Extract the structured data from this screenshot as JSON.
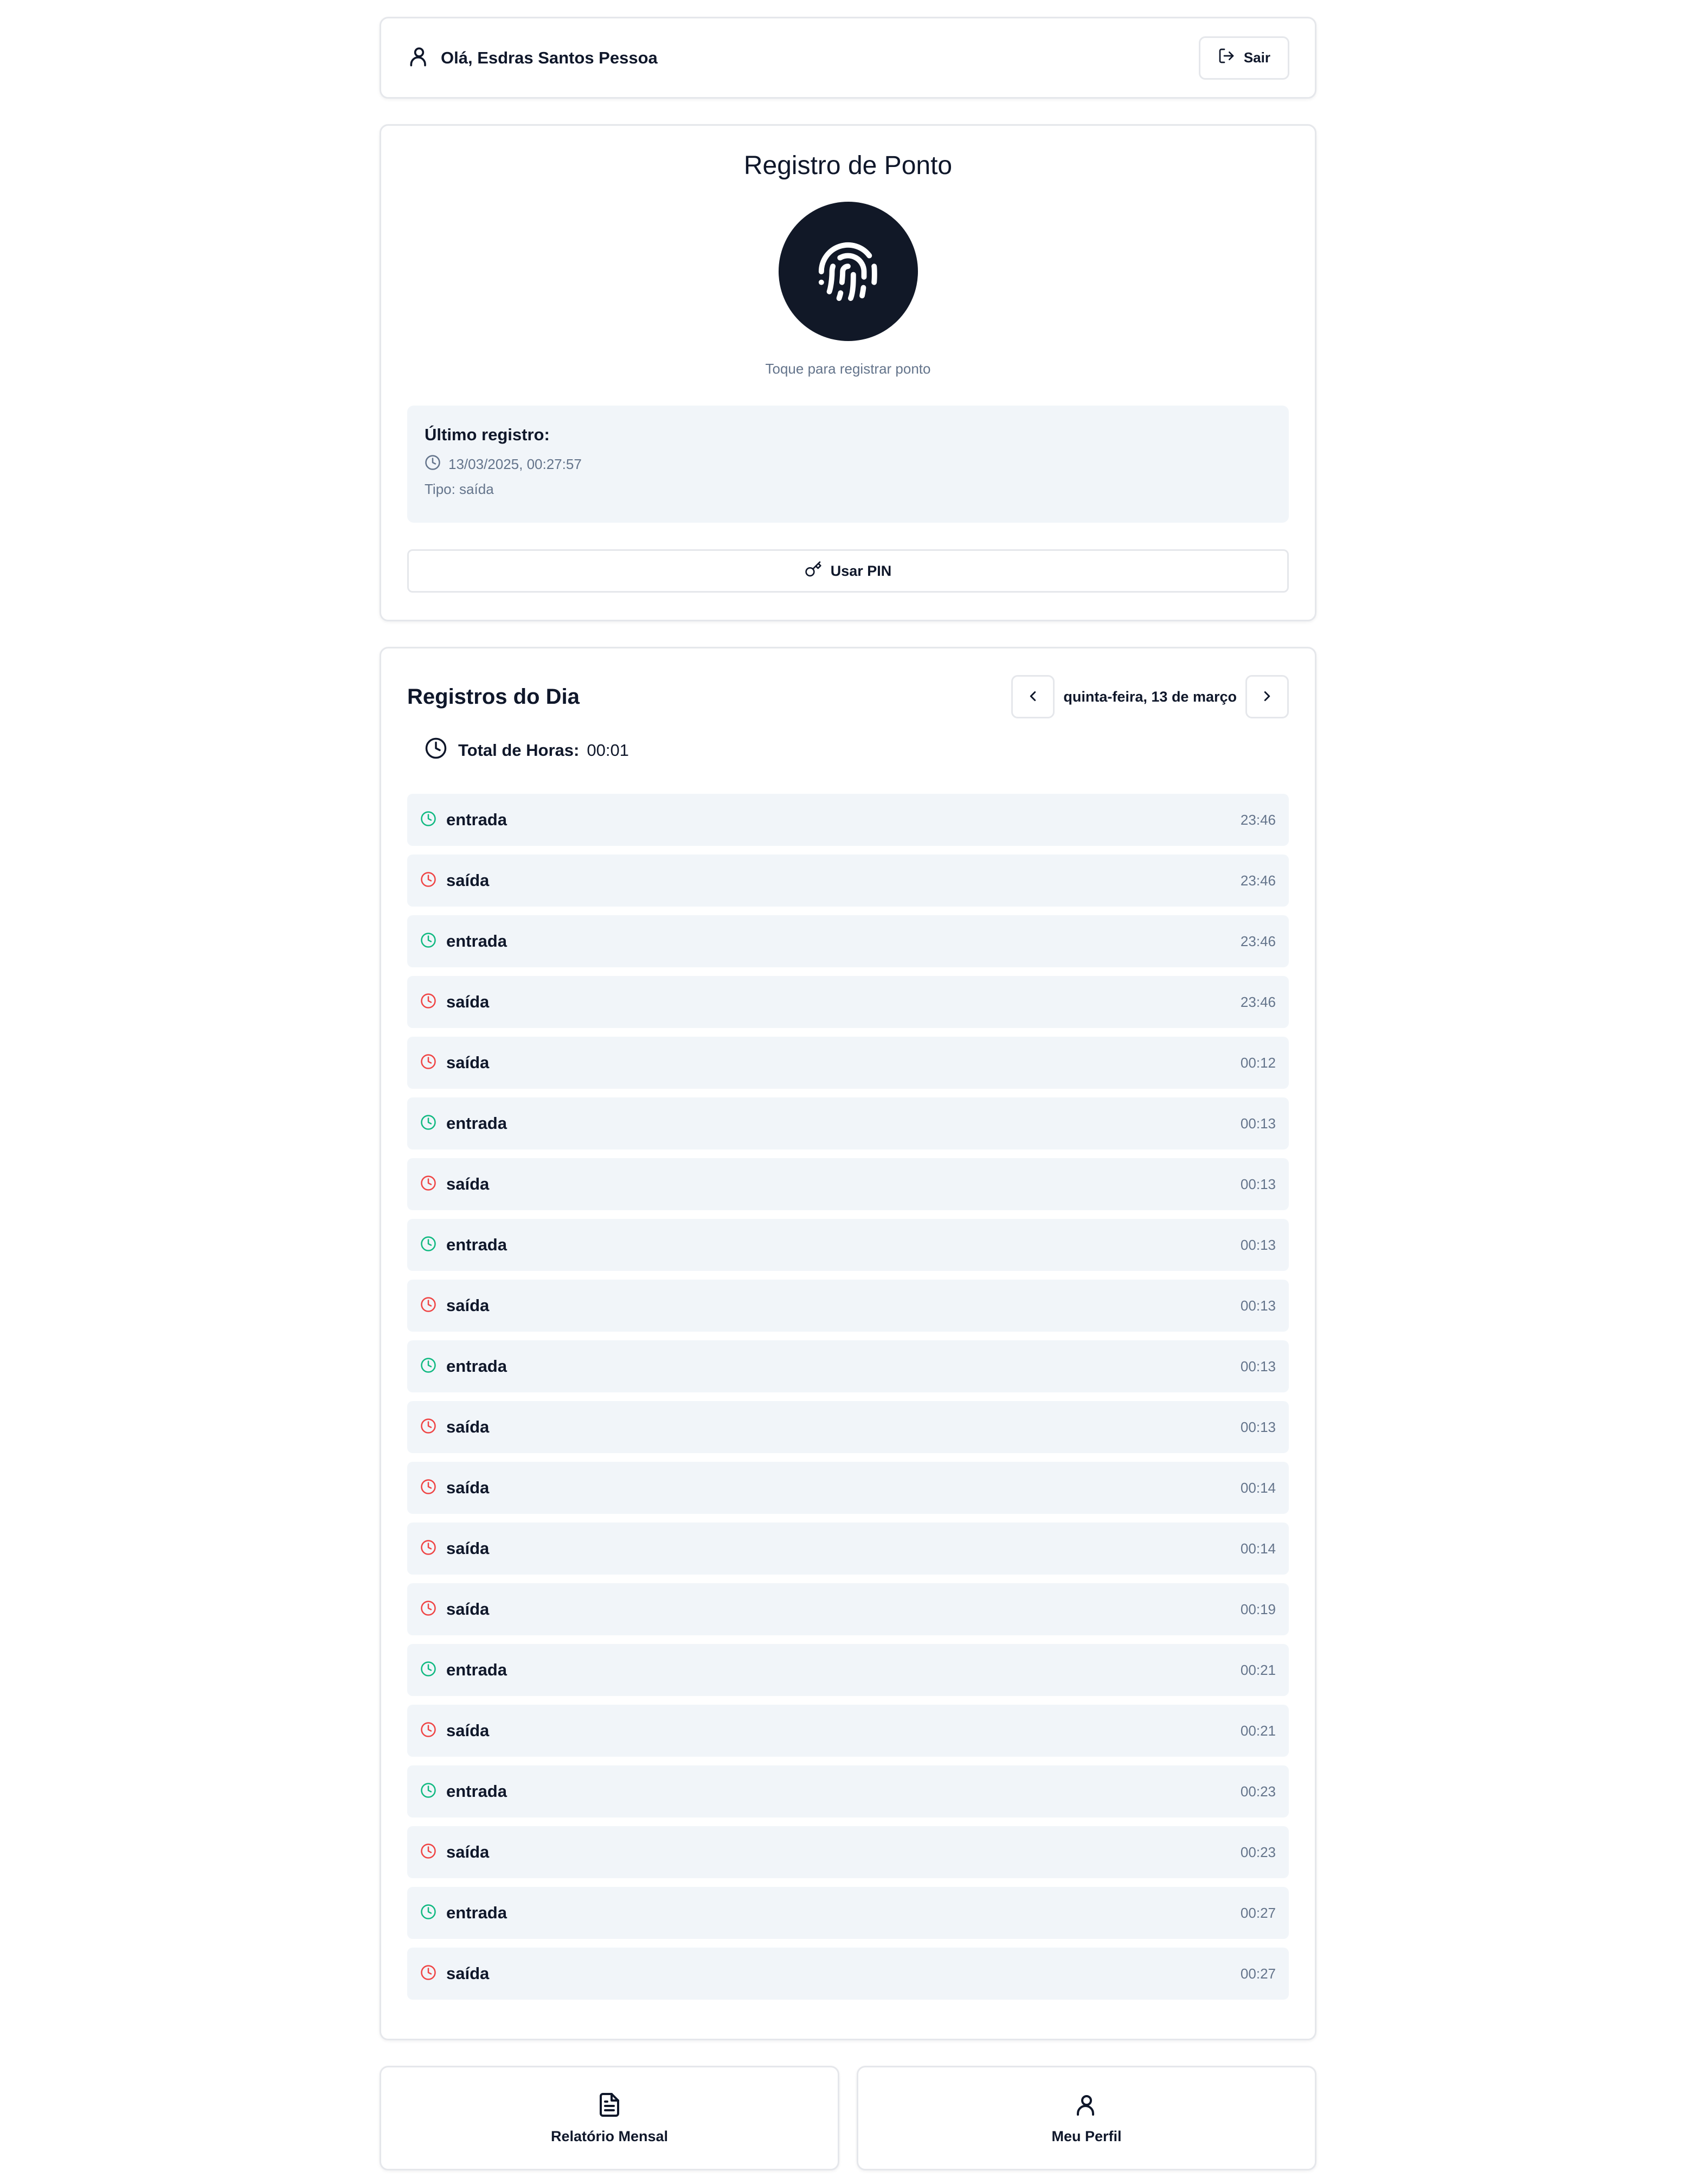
{
  "header": {
    "greeting": "Olá, Esdras Santos Pessoa",
    "logout_label": "Sair",
    "user_icon": "user-icon",
    "logout_icon": "log-out-icon"
  },
  "registro": {
    "title": "Registro de Ponto",
    "fingerprint_icon": "fingerprint-icon",
    "hint": "Toque para registrar ponto",
    "last": {
      "title": "Último registro:",
      "datetime": "13/03/2025, 00:27:57",
      "type": "Tipo: saída"
    },
    "pin_label": "Usar PIN",
    "pin_icon": "key-icon"
  },
  "day": {
    "title": "Registros do Dia",
    "date": "quinta-feira, 13 de março",
    "total_label": "Total de Horas:",
    "total_value": "00:01",
    "records": [
      {
        "type": "entrada",
        "time": "23:46"
      },
      {
        "type": "saída",
        "time": "23:46"
      },
      {
        "type": "entrada",
        "time": "23:46"
      },
      {
        "type": "saída",
        "time": "23:46"
      },
      {
        "type": "saída",
        "time": "00:12"
      },
      {
        "type": "entrada",
        "time": "00:13"
      },
      {
        "type": "saída",
        "time": "00:13"
      },
      {
        "type": "entrada",
        "time": "00:13"
      },
      {
        "type": "saída",
        "time": "00:13"
      },
      {
        "type": "entrada",
        "time": "00:13"
      },
      {
        "type": "saída",
        "time": "00:13"
      },
      {
        "type": "saída",
        "time": "00:14"
      },
      {
        "type": "saída",
        "time": "00:14"
      },
      {
        "type": "saída",
        "time": "00:19"
      },
      {
        "type": "entrada",
        "time": "00:21"
      },
      {
        "type": "saída",
        "time": "00:21"
      },
      {
        "type": "entrada",
        "time": "00:23"
      },
      {
        "type": "saída",
        "time": "00:23"
      },
      {
        "type": "entrada",
        "time": "00:27"
      },
      {
        "type": "saída",
        "time": "00:27"
      }
    ]
  },
  "bottom_nav": {
    "report_label": "Relatório Mensal",
    "report_icon": "file-text-icon",
    "profile_label": "Meu Perfil",
    "profile_icon": "user-icon"
  },
  "colors": {
    "entrada": "#10b981",
    "saida": "#ef4444",
    "fingerprint_bg": "#111827",
    "row_bg": "#f1f5f9",
    "muted_text": "#64748b"
  }
}
